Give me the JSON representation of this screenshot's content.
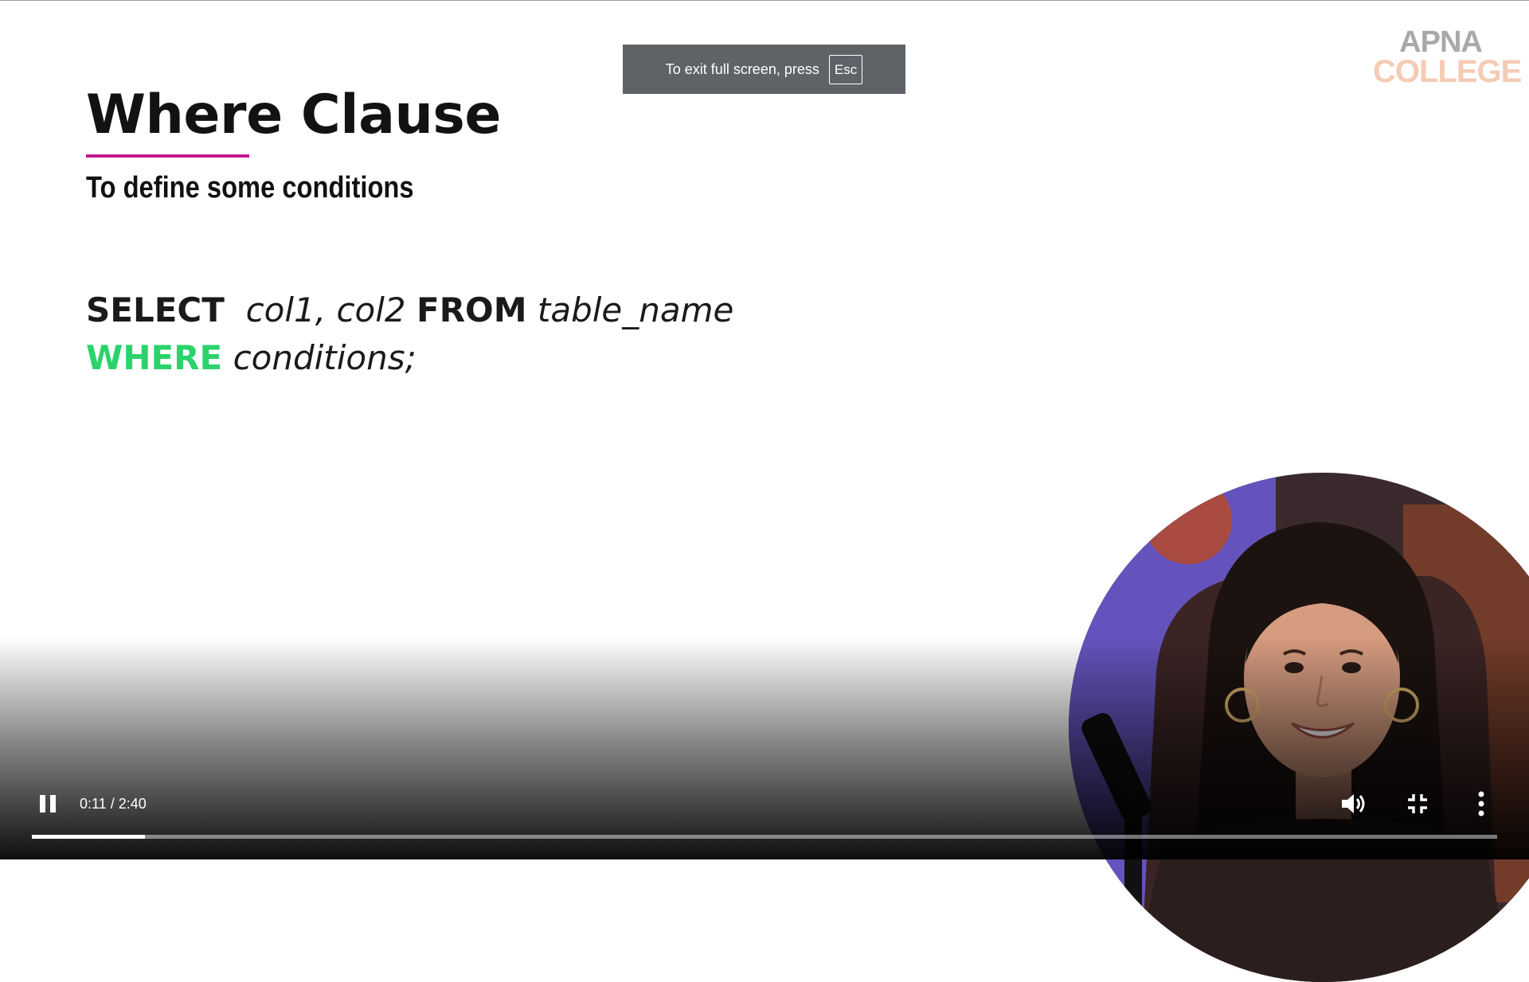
{
  "slide": {
    "title": "Where Clause",
    "subtitle": "To define some conditions",
    "code_line1": {
      "kw_select": "SELECT",
      "cols": "col1, col2",
      "kw_from": "FROM",
      "table": "table_name"
    },
    "code_line2": {
      "kw_where": "WHERE",
      "conditions": "conditions;"
    },
    "accent_underline_color": "#c2178e",
    "keyword_green": "#2bd36b"
  },
  "brand": {
    "line1": "APNA",
    "line2": "COLLEGE"
  },
  "fullscreen_toast": {
    "message": "To exit full screen, press",
    "key": "Esc"
  },
  "player": {
    "current_time": "0:11",
    "duration": "2:40",
    "time_display": "0:11 / 2:40",
    "progress_fraction": 0.077,
    "icons": {
      "play_pause": "pause-icon",
      "volume": "volume-icon",
      "fullscreen": "exit-fullscreen-icon",
      "more": "more-vertical-icon"
    }
  }
}
